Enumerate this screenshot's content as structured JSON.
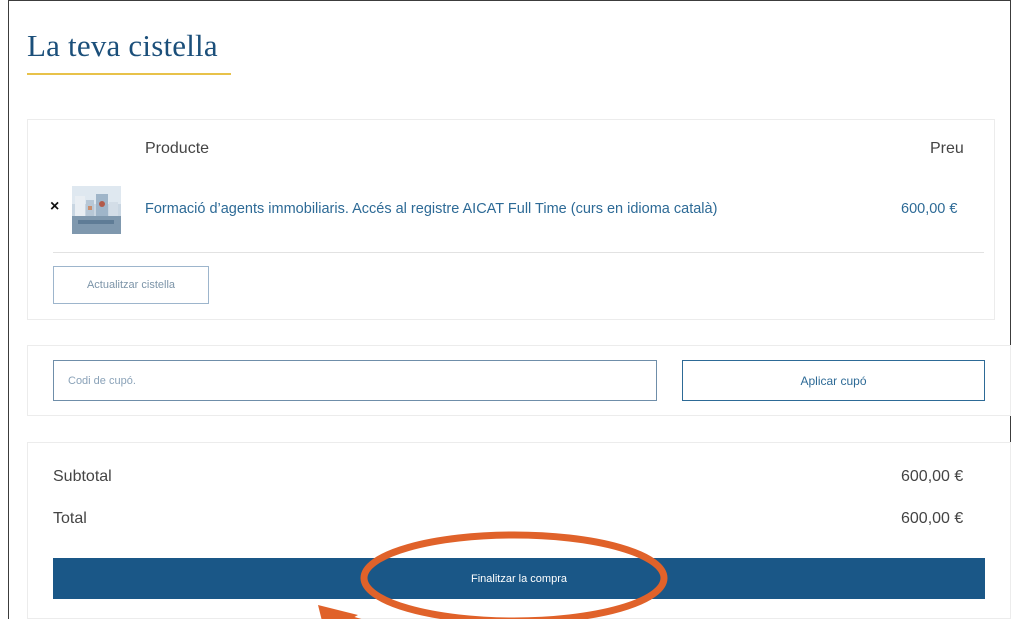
{
  "page": {
    "title": "La teva cistella"
  },
  "cart": {
    "columns": {
      "product": "Producte",
      "price": "Preu"
    },
    "items": [
      {
        "name": "Formació d’agents immobiliaris. Accés al registre AICAT Full Time (curs en idioma català)",
        "price": "600,00 €"
      }
    ],
    "remove_icon": "×",
    "update_label": "Actualitzar cistella"
  },
  "coupon": {
    "placeholder": "Codi de cupó.",
    "apply_label": "Aplicar cupó"
  },
  "totals": {
    "subtotal_label": "Subtotal",
    "subtotal_value": "600,00 €",
    "total_label": "Total",
    "total_value": "600,00 €"
  },
  "checkout": {
    "label": "Finalitzar la compra"
  },
  "colors": {
    "brand_blue": "#1a5787",
    "link_blue": "#2d6a96",
    "title_underline": "#e8c24a",
    "annotation_orange": "#e0622a"
  },
  "icons": {
    "remove": "close-icon",
    "thumbnail": "product-thumbnail",
    "annotation": "highlight-ellipse-with-arrow"
  }
}
